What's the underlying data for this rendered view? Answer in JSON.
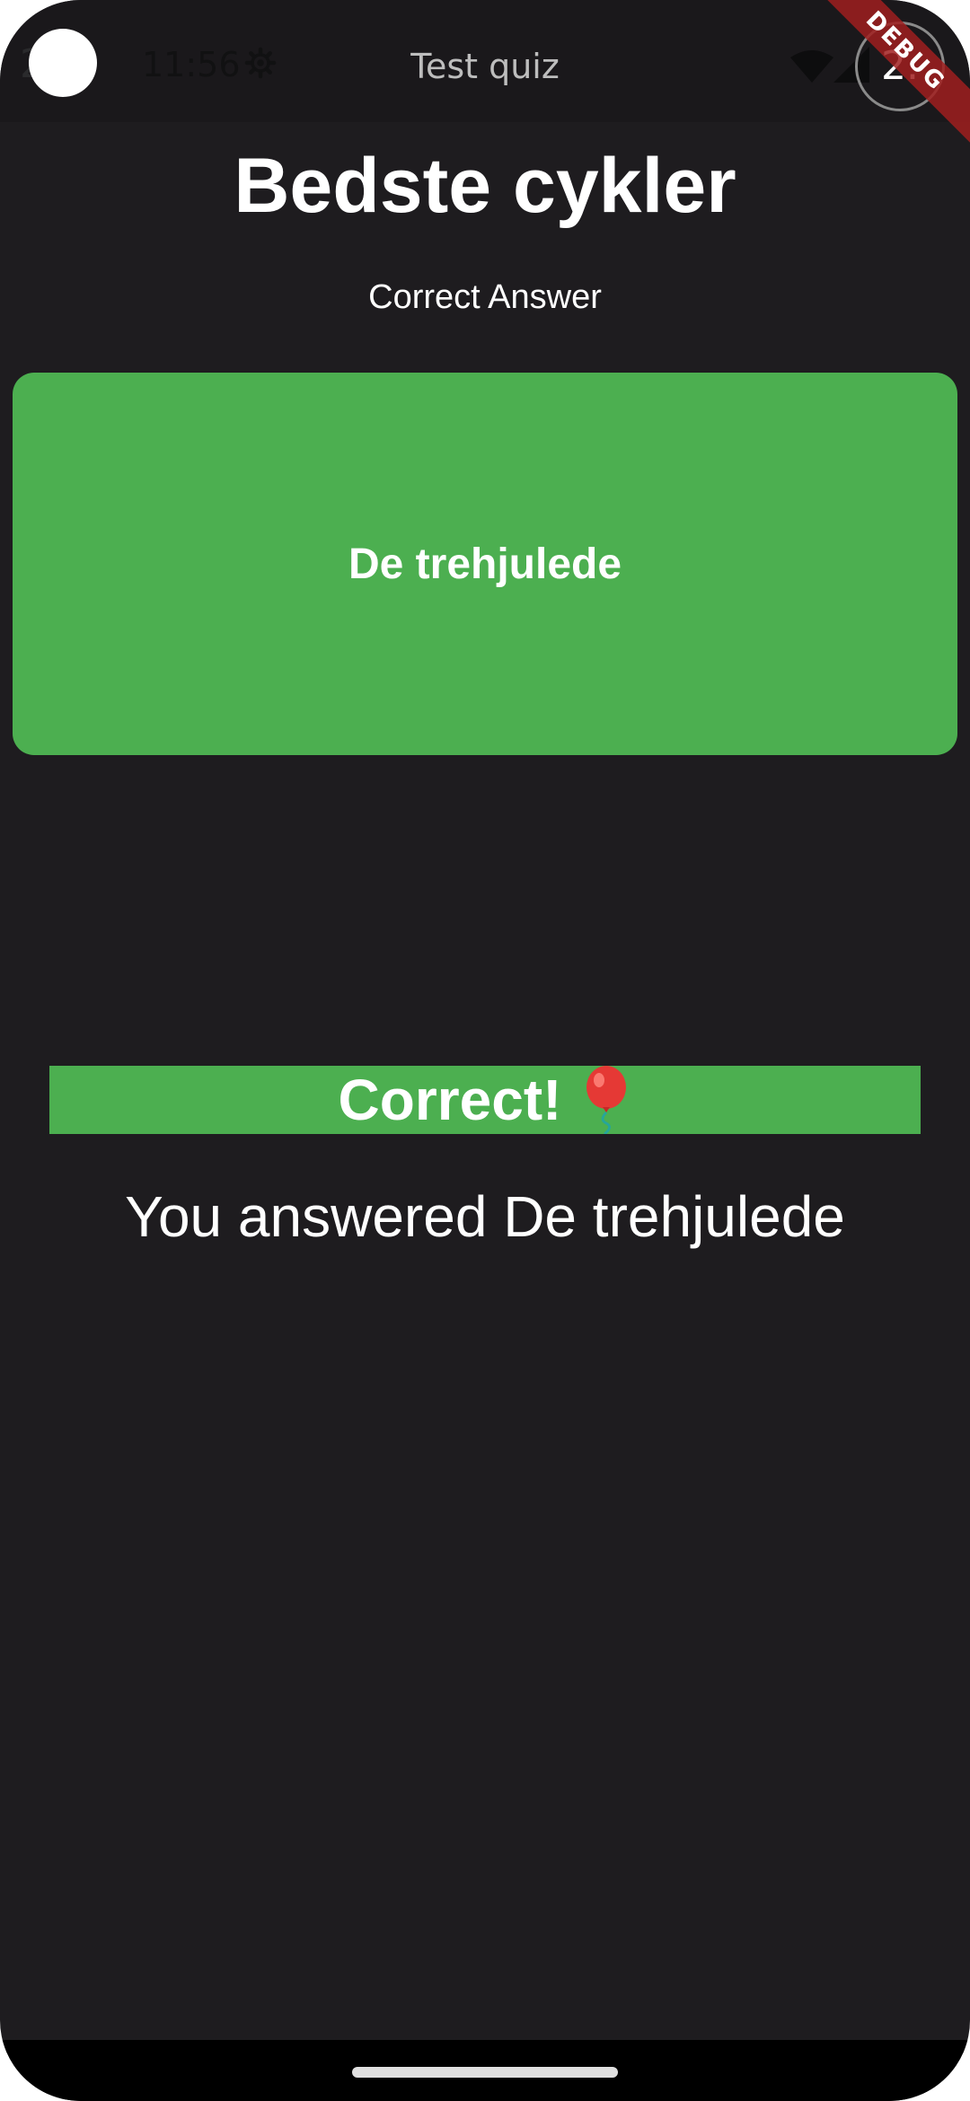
{
  "status_bar": {
    "time_partial": "2",
    "time": "11:56",
    "app_title": "Test quiz",
    "battery_label": "2."
  },
  "debug_banner": "DEBUG",
  "quiz": {
    "title": "Bedste cykler",
    "subtitle": "Correct Answer",
    "correct_answer": "De trehjulede",
    "result_text": "Correct!",
    "answered_text": "You answered De trehjulede"
  },
  "colors": {
    "background": "#1e1c1f",
    "accent_green": "#4caf50",
    "debug_red": "#a01e1e"
  },
  "icons": {
    "settings": "gear-icon",
    "wifi": "wifi-icon",
    "signal": "signal-icon",
    "balloon": "balloon-icon"
  }
}
